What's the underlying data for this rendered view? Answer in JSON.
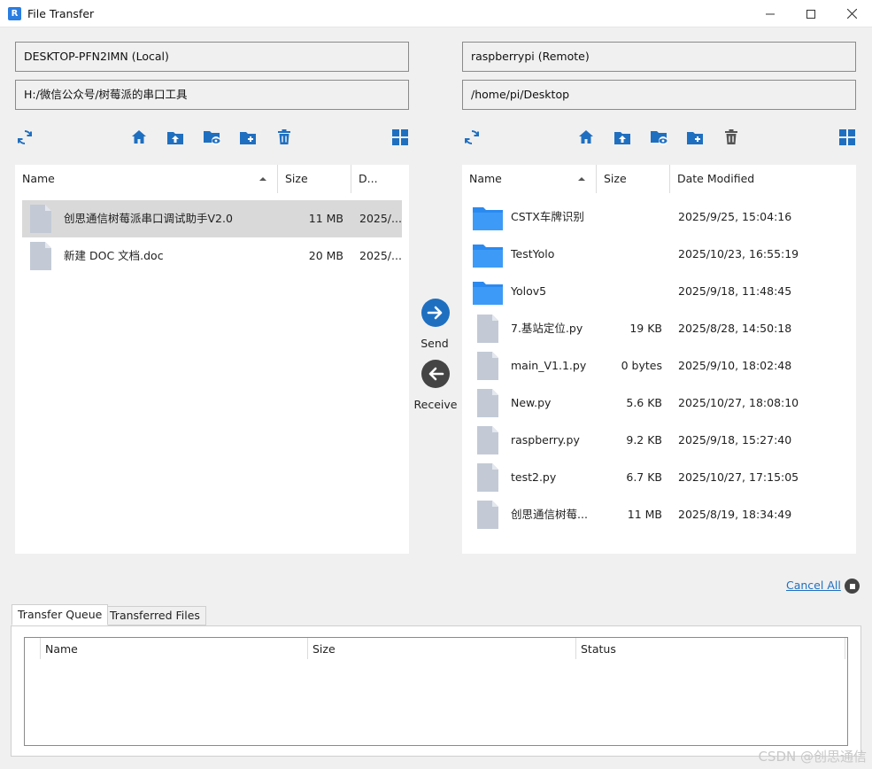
{
  "window": {
    "title": "File Transfer",
    "accent": "#1f6fc0"
  },
  "local": {
    "host": "DESKTOP-PFN2IMN (Local)",
    "path": "H:/微信公众号/树莓派的串口工具",
    "columns": {
      "name": "Name",
      "size": "Size",
      "date": "D..."
    },
    "files": [
      {
        "name": "创思通信树莓派串口调试助手V2.0",
        "size": "11 MB",
        "date": "2025/...",
        "icon": "file-icon",
        "selected": true
      },
      {
        "name": "新建 DOC 文档.doc",
        "size": "20 MB",
        "date": "2025/...",
        "icon": "file-icon",
        "selected": false
      }
    ]
  },
  "remote": {
    "host": "raspberrypi (Remote)",
    "path": "/home/pi/Desktop",
    "columns": {
      "name": "Name",
      "size": "Size",
      "date": "Date Modified"
    },
    "files": [
      {
        "name": "CSTX车牌识别",
        "size": "",
        "date": "2025/9/25, 15:04:16",
        "icon": "folder-icon"
      },
      {
        "name": "TestYolo",
        "size": "",
        "date": "2025/10/23, 16:55:19",
        "icon": "folder-icon"
      },
      {
        "name": "Yolov5",
        "size": "",
        "date": "2025/9/18, 11:48:45",
        "icon": "folder-icon"
      },
      {
        "name": "7.基站定位.py",
        "size": "19 KB",
        "date": "2025/8/28, 14:50:18",
        "icon": "file-icon"
      },
      {
        "name": "main_V1.1.py",
        "size": "0 bytes",
        "date": "2025/9/10, 18:02:48",
        "icon": "file-icon"
      },
      {
        "name": "New.py",
        "size": "5.6 KB",
        "date": "2025/10/27, 18:08:10",
        "icon": "file-icon"
      },
      {
        "name": "raspberry.py",
        "size": "9.2 KB",
        "date": "2025/9/18, 15:27:40",
        "icon": "file-icon"
      },
      {
        "name": "test2.py",
        "size": "6.7 KB",
        "date": "2025/10/27, 17:15:05",
        "icon": "file-icon"
      },
      {
        "name": "创思通信树莓...",
        "size": "11 MB",
        "date": "2025/8/19, 18:34:49",
        "icon": "file-icon"
      }
    ]
  },
  "transfer": {
    "send_label": "Send",
    "receive_label": "Receive",
    "cancel_all": "Cancel All"
  },
  "tabs": {
    "queue": "Transfer Queue",
    "transferred": "Transferred Files"
  },
  "queue_columns": {
    "name": "Name",
    "size": "Size",
    "status": "Status"
  },
  "watermark": "CSDN @创思通信"
}
